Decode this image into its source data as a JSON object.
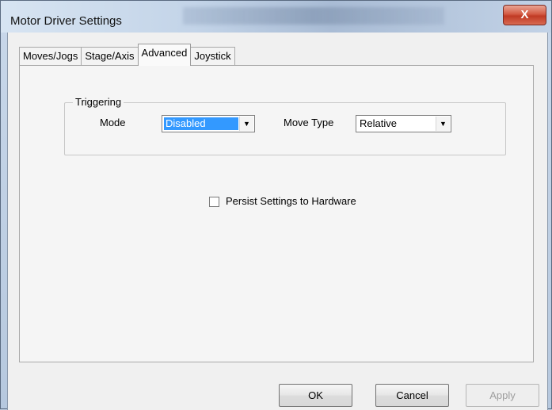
{
  "window": {
    "title": "Motor Driver Settings",
    "close_glyph": "X"
  },
  "tabs": [
    {
      "label": "Moves/Jogs",
      "active": false
    },
    {
      "label": "Stage/Axis",
      "active": false
    },
    {
      "label": "Advanced",
      "active": true
    },
    {
      "label": "Joystick",
      "active": false
    }
  ],
  "triggering": {
    "group_title": "Triggering",
    "mode_label": "Mode",
    "mode_value": "Disabled",
    "move_type_label": "Move Type",
    "move_type_value": "Relative",
    "dropdown_icon": "chevron-down-icon"
  },
  "persist": {
    "label": "Persist Settings to Hardware",
    "checked": false
  },
  "buttons": {
    "ok": "OK",
    "cancel": "Cancel",
    "apply": "Apply"
  },
  "colors": {
    "selection": "#3399ff",
    "close_button": "#c8452f",
    "disabled_text": "#9e9e9e"
  }
}
